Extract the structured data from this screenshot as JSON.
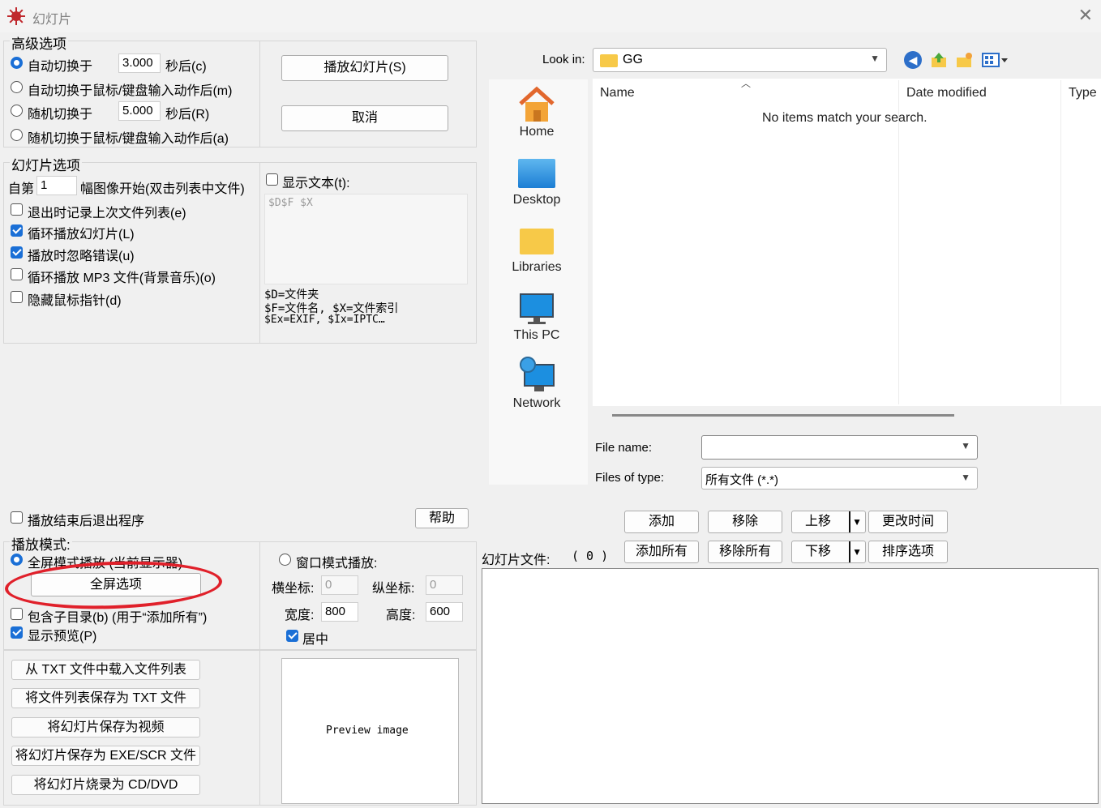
{
  "window": {
    "title": "幻灯片",
    "close": "✕"
  },
  "advanced": {
    "group": "高级选项",
    "auto_switch": "自动切换于",
    "auto_seconds": "3.000",
    "auto_suffix": "秒后(c)",
    "auto_after_input": "自动切换于鼠标/键盘输入动作后(m)",
    "random_switch": "随机切换于",
    "random_seconds": "5.000",
    "random_suffix": "秒后(R)",
    "random_after_input": "随机切换于鼠标/键盘输入动作后(a)",
    "play_button": "播放幻灯片(S)",
    "cancel_button": "取消"
  },
  "slide_options": {
    "group": "幻灯片选项",
    "from_prefix": "自第",
    "from_value": "1",
    "from_suffix": "幅图像开始(双击列表中文件)",
    "record_last": "退出时记录上次文件列表(e)",
    "loop": "循环播放幻灯片(L)",
    "ignore_errors": "播放时忽略错误(u)",
    "loop_mp3": "循环播放 MP3 文件(背景音乐)(o)",
    "hide_cursor": "隐藏鼠标指针(d)",
    "show_text": "显示文本(t):",
    "text_value": "$D$F $X",
    "help_line1": "$D=文件夹",
    "help_line2": "$F=文件名, $X=文件索引",
    "help_line3": "$Ex=EXIF, $Ix=IPTC…"
  },
  "file_dialog": {
    "look_in_label": "Look in:",
    "folder": "GG",
    "nav": [
      "Home",
      "Desktop",
      "Libraries",
      "This PC",
      "Network"
    ],
    "col_name": "Name",
    "col_date": "Date modified",
    "col_type": "Type",
    "empty": "No items match your search.",
    "file_name_label": "File name:",
    "file_name_value": "",
    "files_type_label": "Files of type:",
    "files_type_value": "所有文件 (*.*)"
  },
  "bottom": {
    "exit_after": "播放结束后退出程序",
    "help_button": "帮助",
    "mode_label": "播放模式:",
    "fullscreen_mode": "全屏模式播放 (当前显示器)",
    "fullscreen_options": "全屏选项",
    "include_subdirs": "包含子目录(b) (用于“添加所有”)",
    "show_preview": "显示预览(P)",
    "window_mode": "窗口模式播放:",
    "x_label": "横坐标:",
    "x_value": "0",
    "y_label": "纵坐标:",
    "y_value": "0",
    "width_label": "宽度:",
    "width_value": "800",
    "height_label": "高度:",
    "height_value": "600",
    "center": "居中",
    "load_txt": "从 TXT 文件中载入文件列表",
    "save_txt": "将文件列表保存为 TXT 文件",
    "save_video": "将幻灯片保存为视频",
    "save_exe": "将幻灯片保存为 EXE/SCR 文件",
    "burn_cd": "将幻灯片烧录为 CD/DVD",
    "preview": "Preview image"
  },
  "slide_files": {
    "label": "幻灯片文件:",
    "count": "( 0 )",
    "add": "添加",
    "remove": "移除",
    "move_up": "上移",
    "change_time": "更改时间",
    "add_all": "添加所有",
    "remove_all": "移除所有",
    "move_down": "下移",
    "sort_options": "排序选项"
  },
  "colors": {
    "accent": "#1a6fd6",
    "annotation": "#e0202a"
  }
}
